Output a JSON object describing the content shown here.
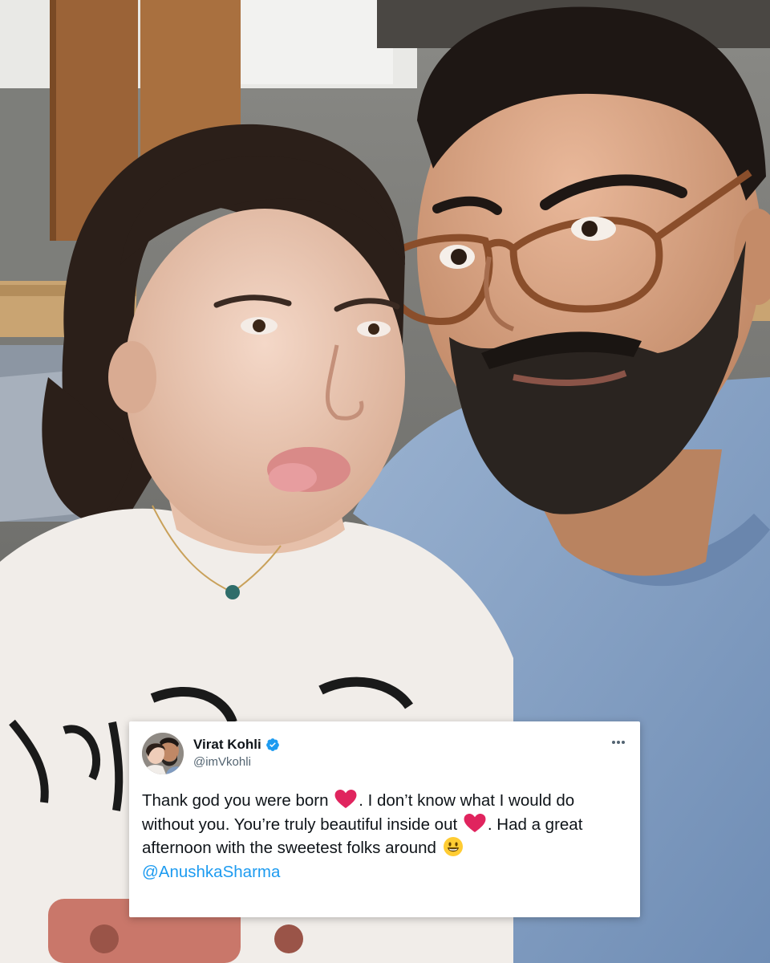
{
  "tweet": {
    "display_name": "Virat Kohli",
    "handle": "@imVkohli",
    "text_part1": "Thank god you were born",
    "text_part2": ". I don’t know what I would do without you. You’re truly beautiful inside out",
    "text_part3": ". Had a great afternoon with the sweetest folks around",
    "mention": "@AnushkaSharma",
    "emojis": [
      "red-heart",
      "red-heart",
      "grinning-face"
    ]
  },
  "colors": {
    "link": "#1d9bf0",
    "verified_badge": "#1d9bf0",
    "heart": "#e0245e",
    "shirt_blue": "#7f9bc0"
  }
}
